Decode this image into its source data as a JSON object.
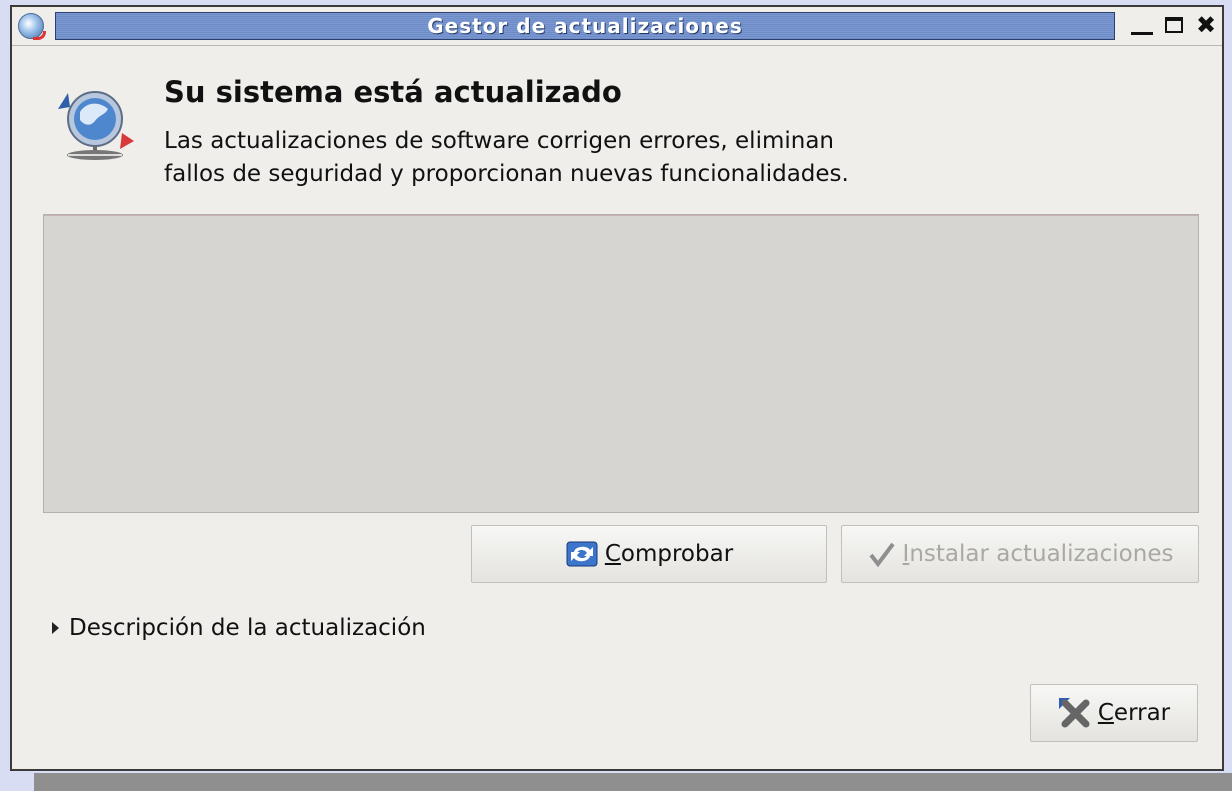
{
  "window": {
    "title": "Gestor de actualizaciones",
    "icons": {
      "app": "update-manager-icon",
      "minimize": "minimize-icon",
      "maximize": "maximize-icon",
      "close": "close-icon"
    }
  },
  "header": {
    "heading": "Su sistema está actualizado",
    "description_line1": "Las actualizaciones de software corrigen errores, eliminan",
    "description_line2": "fallos de seguridad y proporcionan nuevas funcionalidades."
  },
  "buttons": {
    "check": {
      "mnemonic": "C",
      "rest": "omprobar",
      "icon": "refresh-icon"
    },
    "install": {
      "mnemonic": "I",
      "rest": "nstalar actualizaciones",
      "icon": "checkmark-icon",
      "enabled": false
    },
    "close": {
      "mnemonic": "C",
      "rest": "errar",
      "icon": "close-x-icon"
    }
  },
  "expander": {
    "label": "Descripción de la actualización",
    "expanded": false
  },
  "colors": {
    "title_bar": "#6c8bc7",
    "window_bg": "#efeeeb",
    "list_bg": "#d6d5d1"
  }
}
